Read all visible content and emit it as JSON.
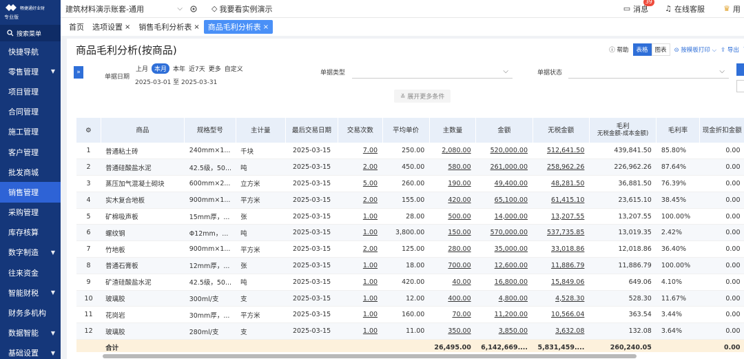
{
  "brand": {
    "name": "畅捷通好业财",
    "edition": "专业版"
  },
  "search": {
    "label": "搜索菜单"
  },
  "nav": [
    {
      "label": "快捷导航",
      "caret": false,
      "active": false
    },
    {
      "label": "零售管理",
      "caret": true,
      "active": false
    },
    {
      "label": "项目管理",
      "caret": false,
      "active": false
    },
    {
      "label": "合同管理",
      "caret": false,
      "active": false
    },
    {
      "label": "施工管理",
      "caret": false,
      "active": false
    },
    {
      "label": "客户管理",
      "caret": false,
      "active": false
    },
    {
      "label": "批发商城",
      "caret": false,
      "active": false
    },
    {
      "label": "销售管理",
      "caret": false,
      "active": true
    },
    {
      "label": "采购管理",
      "caret": false,
      "active": false
    },
    {
      "label": "库存核算",
      "caret": false,
      "active": false
    },
    {
      "label": "数字制造",
      "caret": true,
      "active": false
    },
    {
      "label": "往来资金",
      "caret": false,
      "active": false
    },
    {
      "label": "智能财税",
      "caret": true,
      "active": false
    },
    {
      "label": "财务多机构",
      "caret": false,
      "active": false
    },
    {
      "label": "数据智能",
      "caret": true,
      "active": false
    },
    {
      "label": "基础设置",
      "caret": true,
      "active": false
    }
  ],
  "topbar": {
    "account": "建筑材料演示账套-通用",
    "demo": "我要看实例演示",
    "messages": "消息",
    "message_count": "39",
    "service": "在线客服",
    "user": "用"
  },
  "tabs": [
    {
      "label": "首页",
      "closable": false,
      "active": false
    },
    {
      "label": "选项设置",
      "closable": true,
      "active": false
    },
    {
      "label": "销售毛利分析表",
      "closable": true,
      "active": false
    },
    {
      "label": "商品毛利分析表",
      "closable": true,
      "active": true
    }
  ],
  "header": {
    "title": "商品毛利分析(按商品)",
    "help": "帮助",
    "view_table": "表格",
    "view_chart": "图表",
    "print": "按模板打印",
    "export": "导出"
  },
  "filter": {
    "date_label": "单据日期",
    "periods": [
      "上月",
      "本月",
      "本年",
      "近7天",
      "更多",
      "自定义"
    ],
    "active_period": "本月",
    "date_range": "2025-03-01 至 2025-03-31",
    "type_label": "单据类型",
    "status_label": "单据状态",
    "more": "展开更多条件"
  },
  "table": {
    "columns": [
      "商品",
      "规格型号",
      "主计量",
      "最后交易日期",
      "交易次数",
      "平均单价",
      "主数量",
      "金额",
      "无税金额",
      "毛利\n无税金额-成本金额)",
      "毛利率",
      "现金折扣金额"
    ],
    "rows": [
      [
        "1",
        "普通粘土砖",
        "240mm×1...",
        "千块",
        "2025-03-15",
        "7.00",
        "250.00",
        "2,080.00",
        "520,000.00",
        "512,641.50",
        "439,841.50",
        "85.80%",
        "0.00"
      ],
      [
        "2",
        "普通硅酸盐水泥",
        "42.5级，50...",
        "吨",
        "2025-03-15",
        "2.00",
        "450.00",
        "580.00",
        "261,000.00",
        "258,962.26",
        "226,962.26",
        "87.64%",
        "0.00"
      ],
      [
        "3",
        "蒸压加气混凝土砌块",
        "600mm×2...",
        "立方米",
        "2025-03-15",
        "5.00",
        "260.00",
        "190.00",
        "49,400.00",
        "48,281.50",
        "36,881.50",
        "76.39%",
        "0.00"
      ],
      [
        "4",
        "实木复合地板",
        "900mm×1...",
        "平方米",
        "2025-03-15",
        "2.00",
        "155.00",
        "420.00",
        "65,100.00",
        "61,415.10",
        "23,615.10",
        "38.45%",
        "0.00"
      ],
      [
        "5",
        "矿棉吸声板",
        "15mm厚，...",
        "张",
        "2025-03-15",
        "1.00",
        "28.00",
        "500.00",
        "14,000.00",
        "13,207.55",
        "13,207.55",
        "100.00%",
        "0.00"
      ],
      [
        "6",
        "螺纹钢",
        "Φ12mm，...",
        "吨",
        "2025-03-15",
        "1.00",
        "3,800.00",
        "150.00",
        "570,000.00",
        "537,735.85",
        "13,019.35",
        "2.42%",
        "0.00"
      ],
      [
        "7",
        "竹地板",
        "900mm×1...",
        "平方米",
        "2025-03-15",
        "2.00",
        "125.00",
        "280.00",
        "35,000.00",
        "33,018.86",
        "12,018.86",
        "36.40%",
        "0.00"
      ],
      [
        "8",
        "普通石膏板",
        "12mm厚，...",
        "张",
        "2025-03-15",
        "1.00",
        "18.00",
        "700.00",
        "12,600.00",
        "11,886.79",
        "11,886.79",
        "100.00%",
        "0.00"
      ],
      [
        "9",
        "矿渣硅酸盐水泥",
        "42.5级，50...",
        "吨",
        "2025-03-15",
        "1.00",
        "420.00",
        "40.00",
        "16,800.00",
        "15,849.06",
        "649.06",
        "4.10%",
        "0.00"
      ],
      [
        "10",
        "玻璃胶",
        "300ml/支",
        "支",
        "2025-03-15",
        "1.00",
        "12.00",
        "400.00",
        "4,800.00",
        "4,528.30",
        "528.30",
        "11.67%",
        "0.00"
      ],
      [
        "11",
        "花岗岩",
        "30mm厚，...",
        "平方米",
        "2025-03-15",
        "1.00",
        "160.00",
        "70.00",
        "11,200.00",
        "10,566.04",
        "363.54",
        "3.44%",
        "0.00"
      ],
      [
        "12",
        "玻璃胶",
        "280ml/支",
        "支",
        "2025-03-15",
        "1.00",
        "11.00",
        "350.00",
        "3,850.00",
        "3,632.08",
        "132.08",
        "3.64%",
        "0.00"
      ]
    ],
    "total": [
      "",
      "合计",
      "",
      "",
      "",
      "",
      "",
      "26,495.00",
      "6,142,669....",
      "5,831,459....",
      "260,240.05",
      "",
      "0.00"
    ]
  }
}
